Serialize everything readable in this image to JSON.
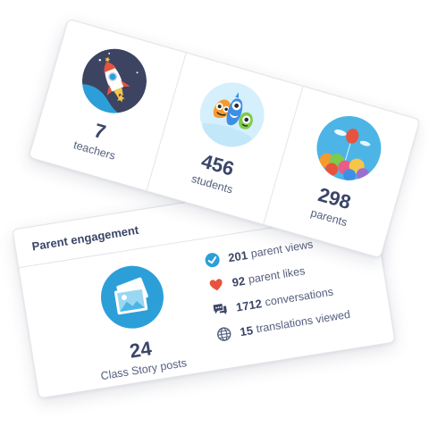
{
  "counts_card": {
    "teachers": {
      "value": "7",
      "label": "teachers",
      "icon": "rocket-icon"
    },
    "students": {
      "value": "456",
      "label": "students",
      "icon": "monsters-icon"
    },
    "parents": {
      "value": "298",
      "label": "parents",
      "icon": "balloons-icon"
    }
  },
  "engagement_card": {
    "title": "Parent engagement",
    "posts": {
      "value": "24",
      "label": "Class Story posts",
      "icon": "photo-icon"
    },
    "stats": [
      {
        "value": "201",
        "label": "parent views",
        "icon": "check-circle-icon"
      },
      {
        "value": "92",
        "label": "parent likes",
        "icon": "heart-icon"
      },
      {
        "value": "1712",
        "label": "conversations",
        "icon": "chat-icon"
      },
      {
        "value": "15",
        "label": "translations viewed",
        "icon": "globe-icon"
      }
    ]
  },
  "colors": {
    "text_dark": "#3a4568",
    "text_muted": "#55607e",
    "accent_blue": "#2c9fd9",
    "heart_red": "#e8533f"
  }
}
